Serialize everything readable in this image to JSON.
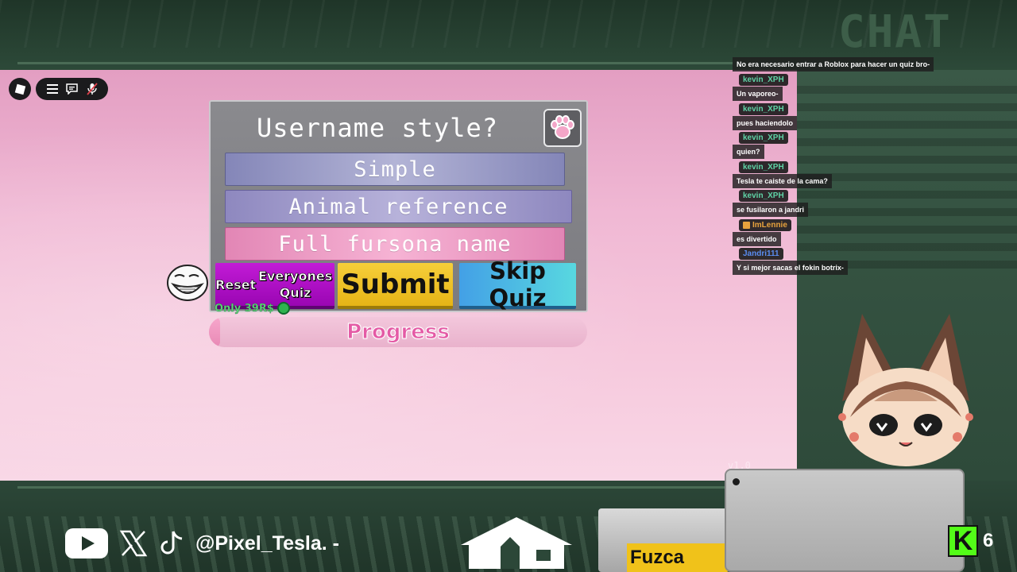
{
  "overlay": {
    "chat_header": "CHAT",
    "social_handle": "@Pixel_Tesla. -",
    "snack_brand": "Fuzca",
    "kick_viewers": "6",
    "version": "v1.0"
  },
  "roblox_ui": {
    "icons": [
      "roblox-logo-icon",
      "hamburger-menu-icon",
      "chat-bubble-icon",
      "microphone-muted-icon"
    ]
  },
  "quiz": {
    "question": "Username style?",
    "options": [
      "Simple",
      "Animal reference",
      "Full fursona name"
    ],
    "reset_button": "Reset Everyones Quiz",
    "reset_price": "Only 39R$",
    "submit_button": "Submit",
    "skip_button": "Skip Quiz",
    "progress_label": "Progress",
    "progress_fraction": 0.03
  },
  "chat": {
    "messages": [
      {
        "user": "",
        "text": "No era necesario entrar a Roblox para hacer un quiz bro-"
      },
      {
        "user": "kevin_XPH",
        "text": "Un vaporeo-"
      },
      {
        "user": "kevin_XPH",
        "text": "pues haciendolo"
      },
      {
        "user": "kevin_XPH",
        "text": "quien?"
      },
      {
        "user": "kevin_XPH",
        "text": "Tesla te caiste de la cama?"
      },
      {
        "user": "kevin_XPH",
        "text": "se fusilaron a jandri"
      },
      {
        "user": "ImLennie",
        "text": "es divertido"
      },
      {
        "user": "Jandri111",
        "text": "Y si mejor sacas el fokin botrix-"
      }
    ]
  },
  "colors": {
    "kevin_XPH": "#5fd3a6",
    "ImLennie": "#e8a33d",
    "Jandri111": "#5a8df0"
  }
}
